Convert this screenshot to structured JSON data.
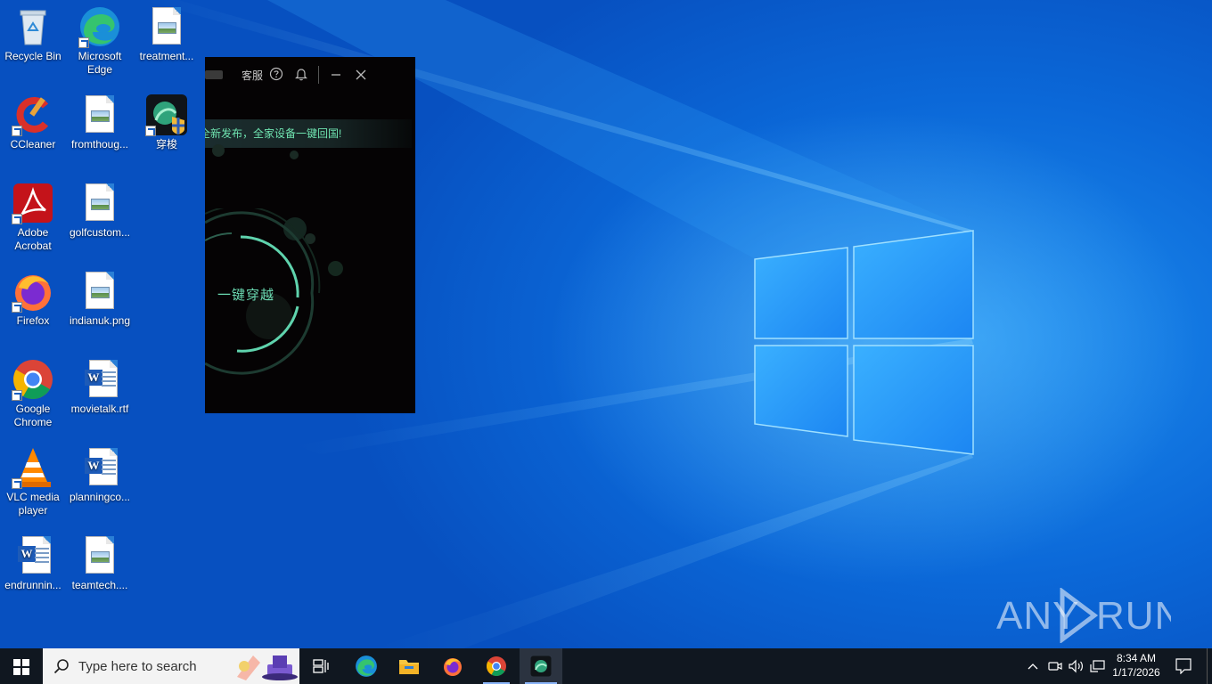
{
  "desktop": {
    "icons": [
      {
        "label": "Recycle Bin",
        "icon": "recycle-bin-icon"
      },
      {
        "label": "Microsoft Edge",
        "icon": "edge-icon"
      },
      {
        "label": "treatment...",
        "icon": "image-file-icon"
      },
      {
        "label": "CCleaner",
        "icon": "ccleaner-icon"
      },
      {
        "label": "fromthoug...",
        "icon": "image-file-icon"
      },
      {
        "label": "穿梭",
        "icon": "chuansuo-app-icon"
      },
      {
        "label": "Adobe Acrobat",
        "icon": "acrobat-icon"
      },
      {
        "label": "golfcustom...",
        "icon": "image-file-icon"
      },
      {
        "label": "Firefox",
        "icon": "firefox-icon"
      },
      {
        "label": "indianuk.png",
        "icon": "image-file-icon"
      },
      {
        "label": "Google Chrome",
        "icon": "chrome-icon"
      },
      {
        "label": "movietalk.rtf",
        "icon": "word-doc-icon"
      },
      {
        "label": "VLC media player",
        "icon": "vlc-icon"
      },
      {
        "label": "planningco...",
        "icon": "word-doc-icon"
      },
      {
        "label": "endrunnin...",
        "icon": "word-doc-icon"
      },
      {
        "label": "teamtech....",
        "icon": "image-file-icon"
      }
    ]
  },
  "app_window": {
    "support_label": "客服",
    "banner_text": "全新发布，全家设备一键回国!",
    "connect_label": "一键穿越",
    "accent_color": "#6ad9b1"
  },
  "taskbar": {
    "search_placeholder": "Type here to search",
    "time": "8:34 AM",
    "date": "1/17/2026",
    "pinned": [
      "task-view-icon",
      "edge-icon",
      "file-explorer-icon",
      "firefox-icon",
      "chrome-icon",
      "chuansuo-app-icon"
    ]
  },
  "watermark": {
    "text": "ANY RUN"
  }
}
